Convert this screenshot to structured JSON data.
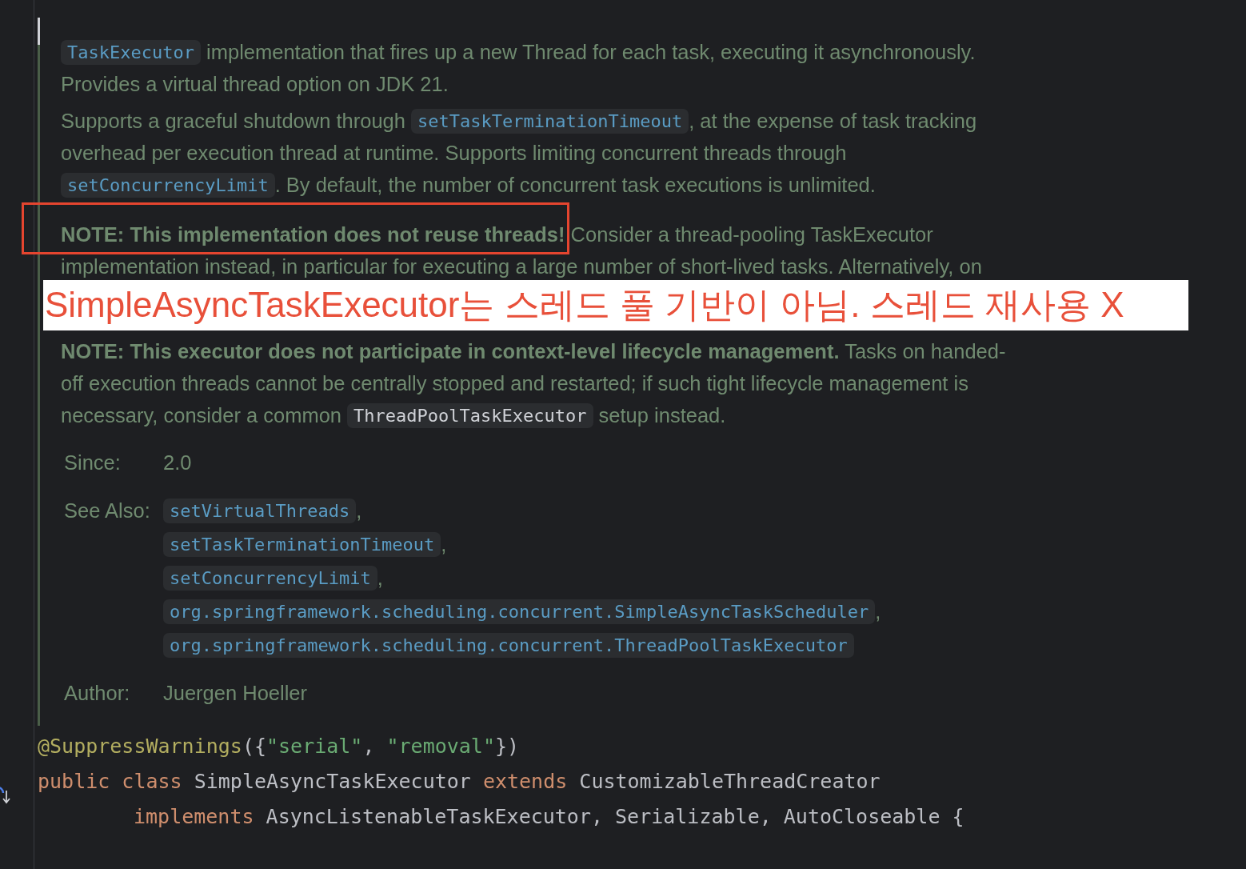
{
  "doc": {
    "paragraphs": [
      {
        "lines": [
          [
            {
              "kind": "link",
              "text": "TaskExecutor"
            },
            {
              "kind": "text",
              "text": " implementation that fires up a new Thread for each task, executing it asynchronously."
            }
          ],
          [
            {
              "kind": "text",
              "text": "Provides a virtual thread option on JDK 21."
            }
          ]
        ]
      },
      {
        "lines": [
          [
            {
              "kind": "text",
              "text": "Supports a graceful shutdown through "
            },
            {
              "kind": "link",
              "text": "setTaskTerminationTimeout"
            },
            {
              "kind": "text",
              "text": ", at the expense of task tracking"
            }
          ],
          [
            {
              "kind": "text",
              "text": "overhead per execution thread at runtime. Supports limiting concurrent threads through"
            }
          ],
          [
            {
              "kind": "link",
              "text": "setConcurrencyLimit"
            },
            {
              "kind": "text",
              "text": ". By default, the number of concurrent task executions is unlimited."
            }
          ]
        ]
      },
      {
        "lines": [
          [
            {
              "kind": "bold",
              "text": "NOTE: This implementation does not reuse threads!",
              "boxed": true
            },
            {
              "kind": "text",
              "text": " Consider a thread-pooling TaskExecutor"
            }
          ],
          [
            {
              "kind": "text",
              "text": "implementation instead, in particular for executing a large number of short-lived tasks. Alternatively, on"
            }
          ]
        ],
        "banner": "SimpleAsyncTaskExecutor는 스레드 풀 기반이 아님. 스레드 재사용 X"
      },
      {
        "lines": [
          [
            {
              "kind": "bold",
              "text": "NOTE: This executor does not participate in context-level lifecycle management."
            },
            {
              "kind": "text",
              "text": " Tasks on handed-"
            }
          ],
          [
            {
              "kind": "text",
              "text": "off execution threads cannot be centrally stopped and restarted; if such tight lifecycle management is"
            }
          ],
          [
            {
              "kind": "text",
              "text": "necessary, consider a common "
            },
            {
              "kind": "code",
              "text": "ThreadPoolTaskExecutor"
            },
            {
              "kind": "text",
              "text": " setup instead."
            }
          ]
        ]
      }
    ],
    "tags": [
      {
        "label": "Since:",
        "values": [
          {
            "kind": "text",
            "text": "2.0"
          }
        ]
      },
      {
        "label": "See Also:",
        "values": [
          {
            "kind": "link",
            "text": "setVirtualThreads",
            "suffix": ","
          },
          {
            "kind": "link",
            "text": "setTaskTerminationTimeout",
            "suffix": ","
          },
          {
            "kind": "link",
            "text": "setConcurrencyLimit",
            "suffix": ","
          },
          {
            "kind": "link",
            "text": "org.springframework.scheduling.concurrent.SimpleAsyncTaskScheduler",
            "suffix": ","
          },
          {
            "kind": "link",
            "text": "org.springframework.scheduling.concurrent.ThreadPoolTaskExecutor"
          }
        ]
      },
      {
        "label": "Author:",
        "values": [
          {
            "kind": "text",
            "text": "Juergen Hoeller"
          }
        ]
      }
    ]
  },
  "code": [
    {
      "kind": "line",
      "tokens": [
        {
          "kind": "annotation",
          "text": "@SuppressWarnings"
        },
        {
          "kind": "plain",
          "text": "({"
        },
        {
          "kind": "string",
          "text": "\"serial\""
        },
        {
          "kind": "plain",
          "text": ", "
        },
        {
          "kind": "string",
          "text": "\"removal\""
        },
        {
          "kind": "plain",
          "text": "})"
        }
      ]
    },
    {
      "kind": "line",
      "tokens": [
        {
          "kind": "keyword",
          "text": "public class "
        },
        {
          "kind": "plain",
          "text": "SimpleAsyncTaskExecutor "
        },
        {
          "kind": "keyword",
          "text": "extends "
        },
        {
          "kind": "plain",
          "text": "CustomizableThreadCreator"
        }
      ]
    },
    {
      "kind": "continuation",
      "tokens": [
        {
          "kind": "keyword",
          "text": "implements "
        },
        {
          "kind": "plain",
          "text": "AsyncListenableTaskExecutor, Serializable, AutoCloseable {"
        }
      ]
    }
  ]
}
